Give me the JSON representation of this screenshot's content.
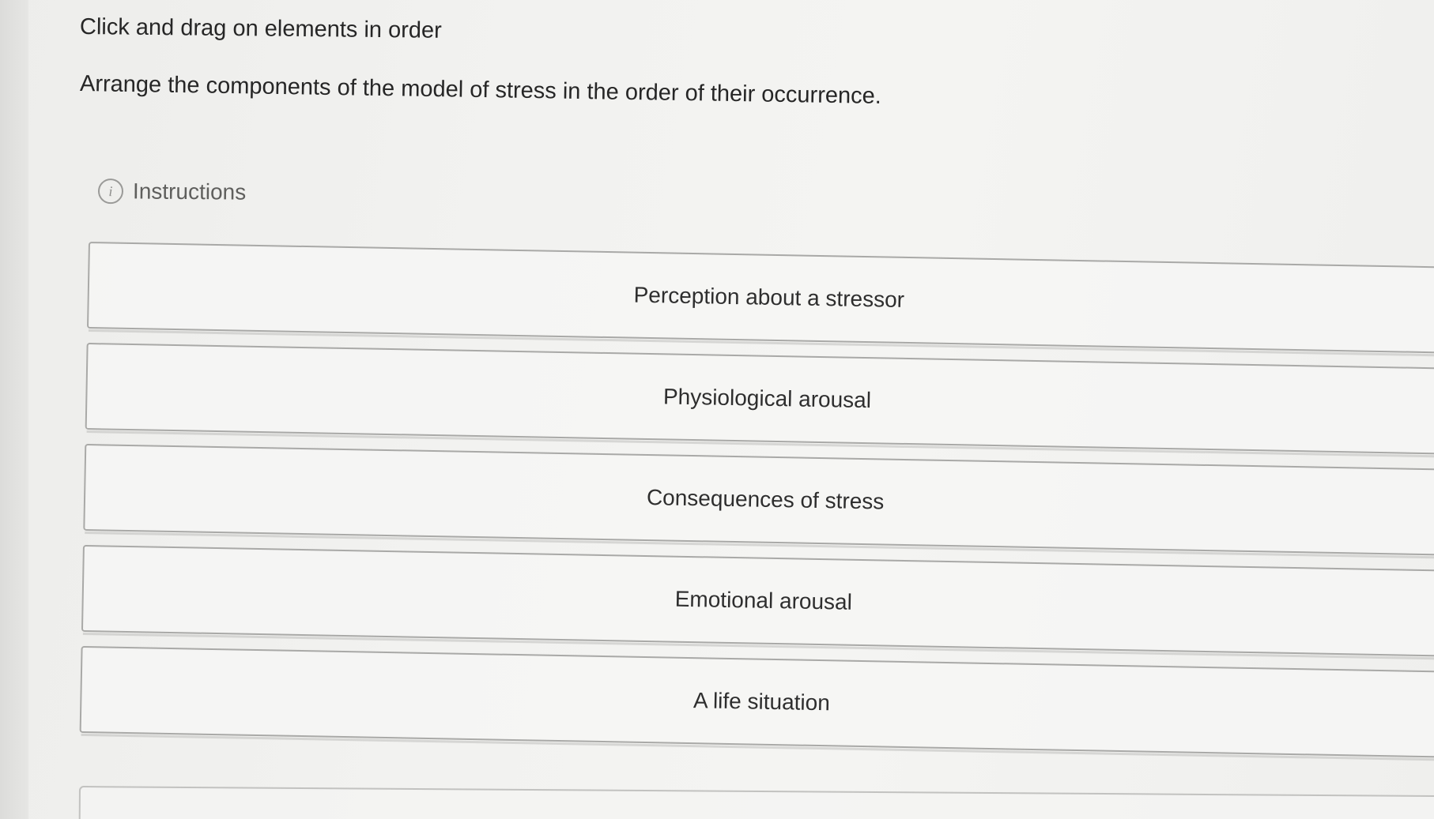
{
  "prompt": {
    "title": "Click and drag on elements in order",
    "question": "Arrange the components of the model of stress in the order of their occurrence."
  },
  "instructions": {
    "icon": "info-icon",
    "icon_glyph": "i",
    "label": "Instructions"
  },
  "items": [
    {
      "label": "Perception about a stressor"
    },
    {
      "label": "Physiological arousal"
    },
    {
      "label": "Consequences of stress"
    },
    {
      "label": "Emotional arousal"
    },
    {
      "label": "A life situation"
    }
  ]
}
